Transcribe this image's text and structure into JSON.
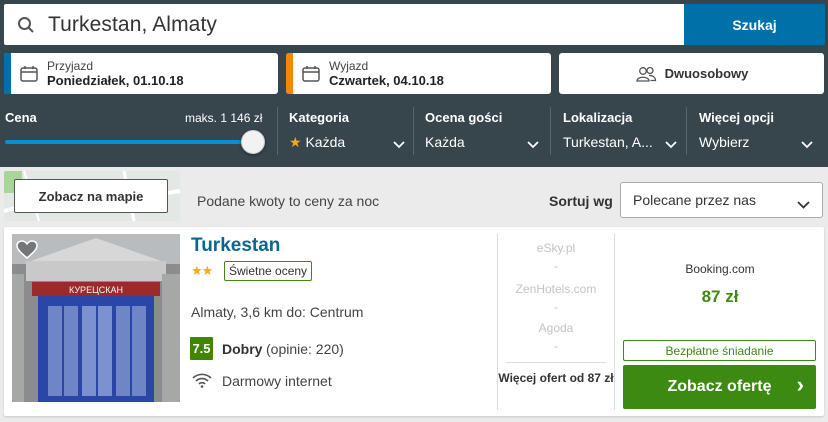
{
  "search": {
    "value": "Turkestan, Almaty",
    "button": "Szukaj"
  },
  "checkin": {
    "label": "Przyjazd",
    "value": "Poniedziałek, 01.10.18",
    "accent": "#0070a8"
  },
  "checkout": {
    "label": "Wyjazd",
    "value": "Czwartek, 04.10.18",
    "accent": "#f18a00"
  },
  "room": {
    "label": "Dwuosobowy",
    "icon": "guests-icon"
  },
  "filters": {
    "price": {
      "label": "Cena",
      "max_text": "maks. 1 146 zł",
      "slider_fraction": 1.0
    },
    "category": {
      "label": "Kategoria",
      "value": "Każda",
      "icon": "star-icon"
    },
    "guest_rating": {
      "label": "Ocena gości",
      "value": "Każda"
    },
    "location": {
      "label": "Lokalizacja",
      "value": "Turkestan, A..."
    },
    "more": {
      "label": "Więcej opcji",
      "value": "Wybierz"
    }
  },
  "results_bar": {
    "map_button": "Zobacz na mapie",
    "price_note": "Podane kwoty to ceny za noc",
    "sort_label": "Sortuj wg",
    "sort_value": "Polecane przez nas"
  },
  "hotel": {
    "name": "Turkestan",
    "stars": 2,
    "stars_text": "★★",
    "rating_tag": "Świetne oceny",
    "location": "Almaty, 3,6 km do: Centrum",
    "score": "7.5",
    "score_label": "Dobry",
    "score_count": "(opinie: 220)",
    "amenity": "Darmowy internet",
    "photo_sign": "КУРЕЦСКАН",
    "providers": [
      {
        "name": "eSky.pl",
        "price": "-"
      },
      {
        "name": "ZenHotels.com",
        "price": "-"
      },
      {
        "name": "Agoda",
        "price": "-"
      }
    ],
    "more_offers": "Więcej ofert od 87 zł",
    "best_provider": "Booking.com",
    "best_price": "87 zł",
    "breakfast": "Bezpłatne śniadanie",
    "cta": "Zobacz ofertę",
    "cta_arrow": "›"
  }
}
